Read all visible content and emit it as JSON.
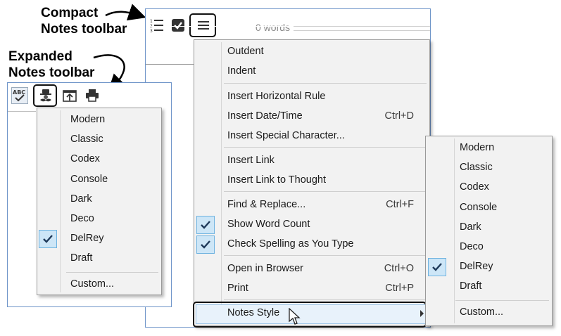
{
  "callouts": {
    "compact": "Compact\nNotes toolbar",
    "expanded": "Expanded\nNotes toolbar"
  },
  "compact_window": {
    "word_count": "0 words",
    "icons": [
      "numbered-list-icon",
      "checkbox-icon",
      "hamburger-menu-icon"
    ]
  },
  "expanded_window": {
    "icons": [
      "spellcheck-abc-icon",
      "notes-style-mustache-icon",
      "open-in-browser-icon",
      "print-icon"
    ]
  },
  "main_menu": {
    "items": [
      {
        "label": "Outdent",
        "shortcut": ""
      },
      {
        "label": "Indent",
        "shortcut": ""
      },
      {
        "label": "Insert Horizontal Rule",
        "shortcut": ""
      },
      {
        "label": "Insert Date/Time",
        "shortcut": "Ctrl+D"
      },
      {
        "label": "Insert Special Character...",
        "shortcut": ""
      },
      {
        "label": "Insert Link",
        "shortcut": ""
      },
      {
        "label": "Insert Link to Thought",
        "shortcut": ""
      },
      {
        "label": "Find & Replace...",
        "shortcut": "Ctrl+F"
      },
      {
        "label": "Show Word Count",
        "shortcut": "",
        "checked": true
      },
      {
        "label": "Check Spelling as You Type",
        "shortcut": "",
        "checked": true
      },
      {
        "label": "Open in Browser",
        "shortcut": "Ctrl+O"
      },
      {
        "label": "Print",
        "shortcut": "Ctrl+P"
      },
      {
        "label": "Notes Style",
        "shortcut": "",
        "submenu": true
      }
    ]
  },
  "style_menu": {
    "items": [
      "Modern",
      "Classic",
      "Codex",
      "Console",
      "Dark",
      "Deco",
      "DelRey",
      "Draft"
    ],
    "custom": "Custom...",
    "checked_index": 6
  },
  "colors": {
    "window_border": "#6f95c9",
    "menu_bg": "#f2f2f2",
    "check_bg": "#cde6f7",
    "check_border": "#6fb3e0",
    "highlight": "#111111"
  }
}
